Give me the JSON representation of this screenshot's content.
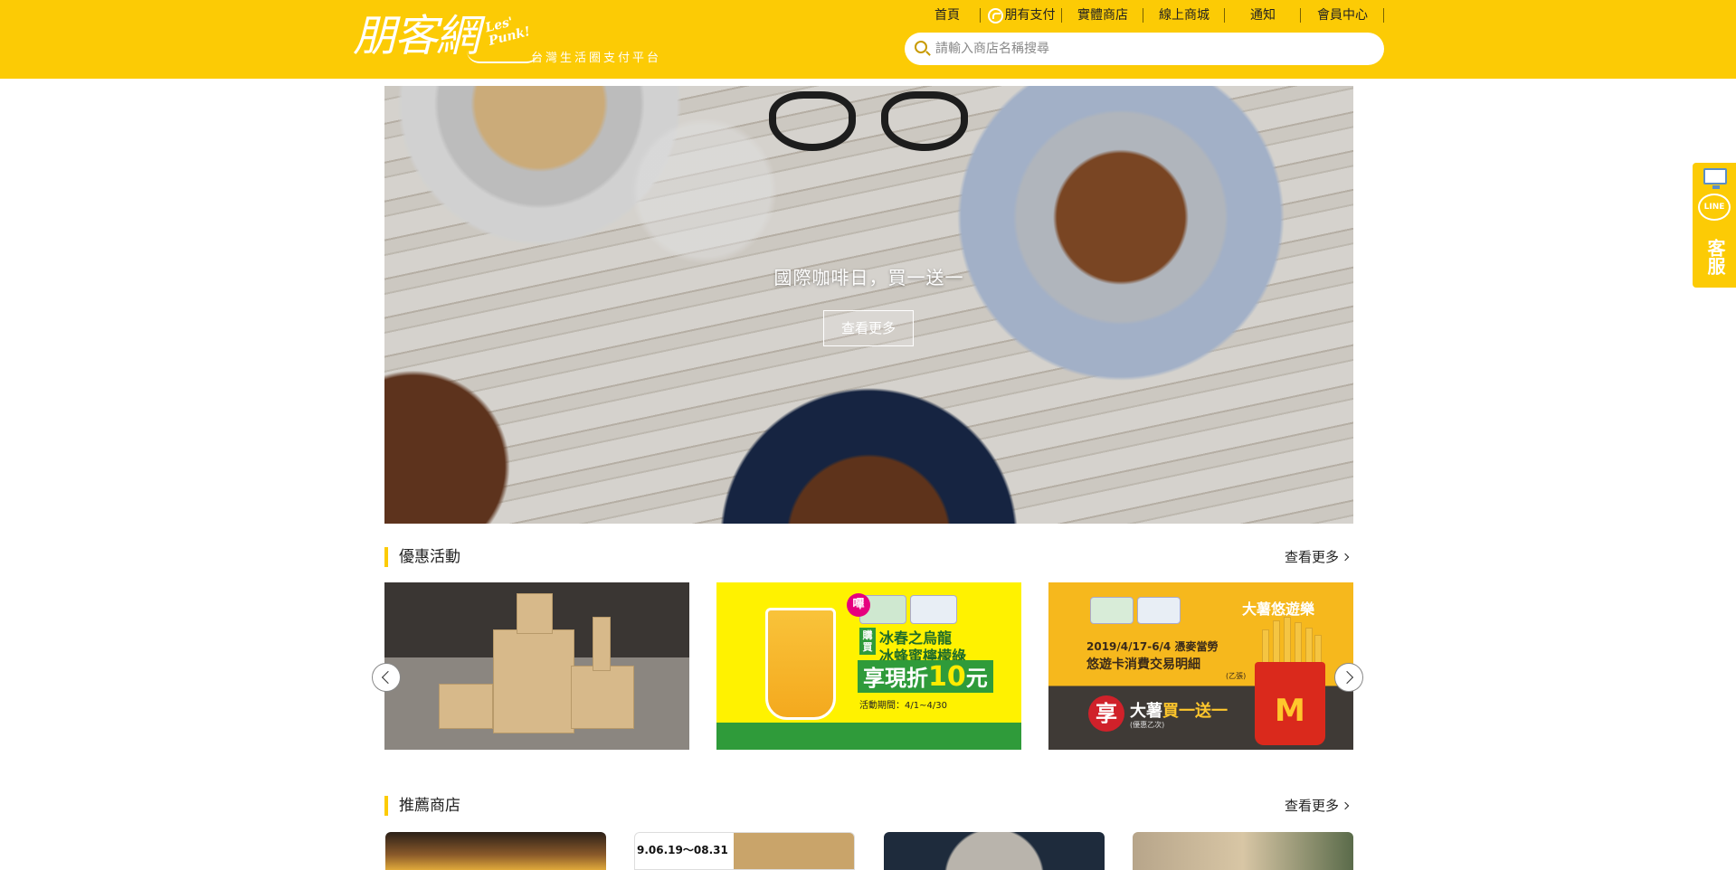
{
  "header": {
    "logo_main": "朋客網",
    "logo_script": "Les' Punk!",
    "logo_tagline": "台灣生活圈支付平台",
    "nav": [
      {
        "label": "首頁",
        "icon": ""
      },
      {
        "label": "朋有支付",
        "icon": "pay-icon"
      },
      {
        "label": "實體商店",
        "icon": ""
      },
      {
        "label": "線上商城",
        "icon": ""
      },
      {
        "label": "通知",
        "icon": ""
      },
      {
        "label": "會員中心",
        "icon": ""
      }
    ],
    "search": {
      "placeholder": "請輸入商店名稱搜尋",
      "value": ""
    }
  },
  "hero": {
    "title": "國際咖啡日，買一送一",
    "button_label": "查看更多"
  },
  "side_widget": {
    "line_label": "LINE",
    "label": "客服"
  },
  "promotions": {
    "title": "優惠活動",
    "more_label": "查看更多",
    "banners": [
      {
        "alt": "木作積木"
      },
      {
        "tag": "嗶",
        "buy": "購買",
        "item1": "冰春之烏龍",
        "item2": "冰蜂蜜檸檬綠",
        "discount_prefix": "享現折",
        "discount_value": "10",
        "discount_unit": "元",
        "period": "活動期間：4/1~4/30"
      },
      {
        "headline": "大薯悠遊樂",
        "date_line": "2019/4/17-6/4 憑麥當勞",
        "detail_line": "悠遊卡消費交易明細",
        "detail_note": "(乙張)",
        "badge": "享",
        "offer_prefix": "大薯",
        "offer": "買一送一",
        "offer_note": "(優惠乙次)",
        "brand_glyph": "M"
      }
    ]
  },
  "stores": {
    "title": "推薦商店",
    "more_label": "查看更多",
    "cards": [
      {
        "caption": ""
      },
      {
        "caption": "9.06.19～08.31"
      },
      {
        "caption": ""
      },
      {
        "caption": ""
      }
    ]
  },
  "colors": {
    "brand_yellow": "#fccb05",
    "promo_green": "#2f9b3a",
    "mcd_red": "#da291c"
  }
}
